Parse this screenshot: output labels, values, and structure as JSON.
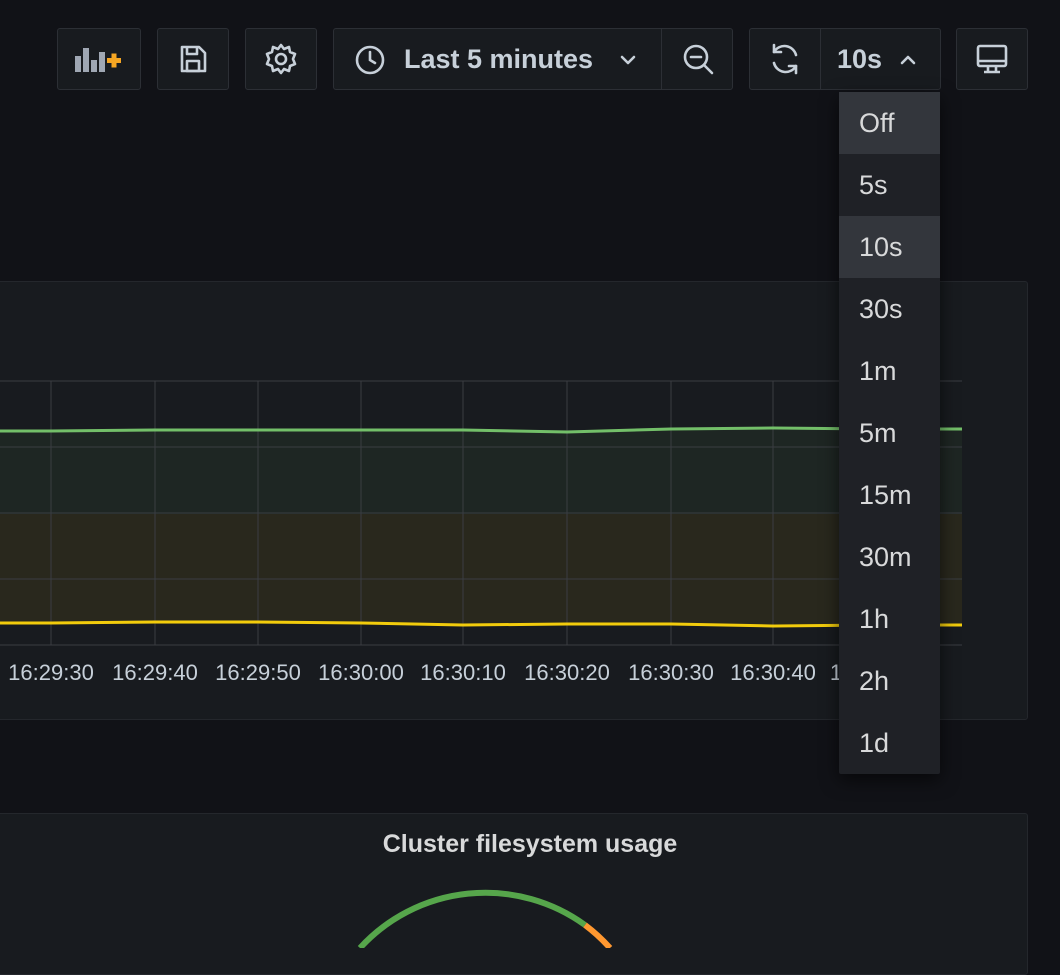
{
  "toolbar": {
    "time_range_label": "Last 5 minutes",
    "refresh_interval_label": "10s"
  },
  "refresh_menu": {
    "options": [
      "Off",
      "5s",
      "10s",
      "30s",
      "1m",
      "5m",
      "15m",
      "30m",
      "1h",
      "2h",
      "1d"
    ],
    "highlighted": [
      "Off",
      "10s"
    ]
  },
  "graph_panel": {
    "x_ticks": [
      "16:29:30",
      "16:29:40",
      "16:29:50",
      "16:30:00",
      "16:30:10",
      "16:30:20",
      "16:30:30",
      "16:30:40",
      "1"
    ]
  },
  "filesystem_panel": {
    "title": "Cluster filesystem usage"
  },
  "colors": {
    "green_series": "#73bf69",
    "yellow_series": "#f2cc0c",
    "gauge_green": "#56a64b",
    "gauge_orange": "#ff9830",
    "add_panel_plus": "#f5a623"
  },
  "icons": [
    "add-panel-icon",
    "save-icon",
    "gear-icon",
    "clock-icon",
    "chevron-down-icon",
    "zoom-out-icon",
    "refresh-icon",
    "chevron-up-icon",
    "tv-mode-icon"
  ]
}
